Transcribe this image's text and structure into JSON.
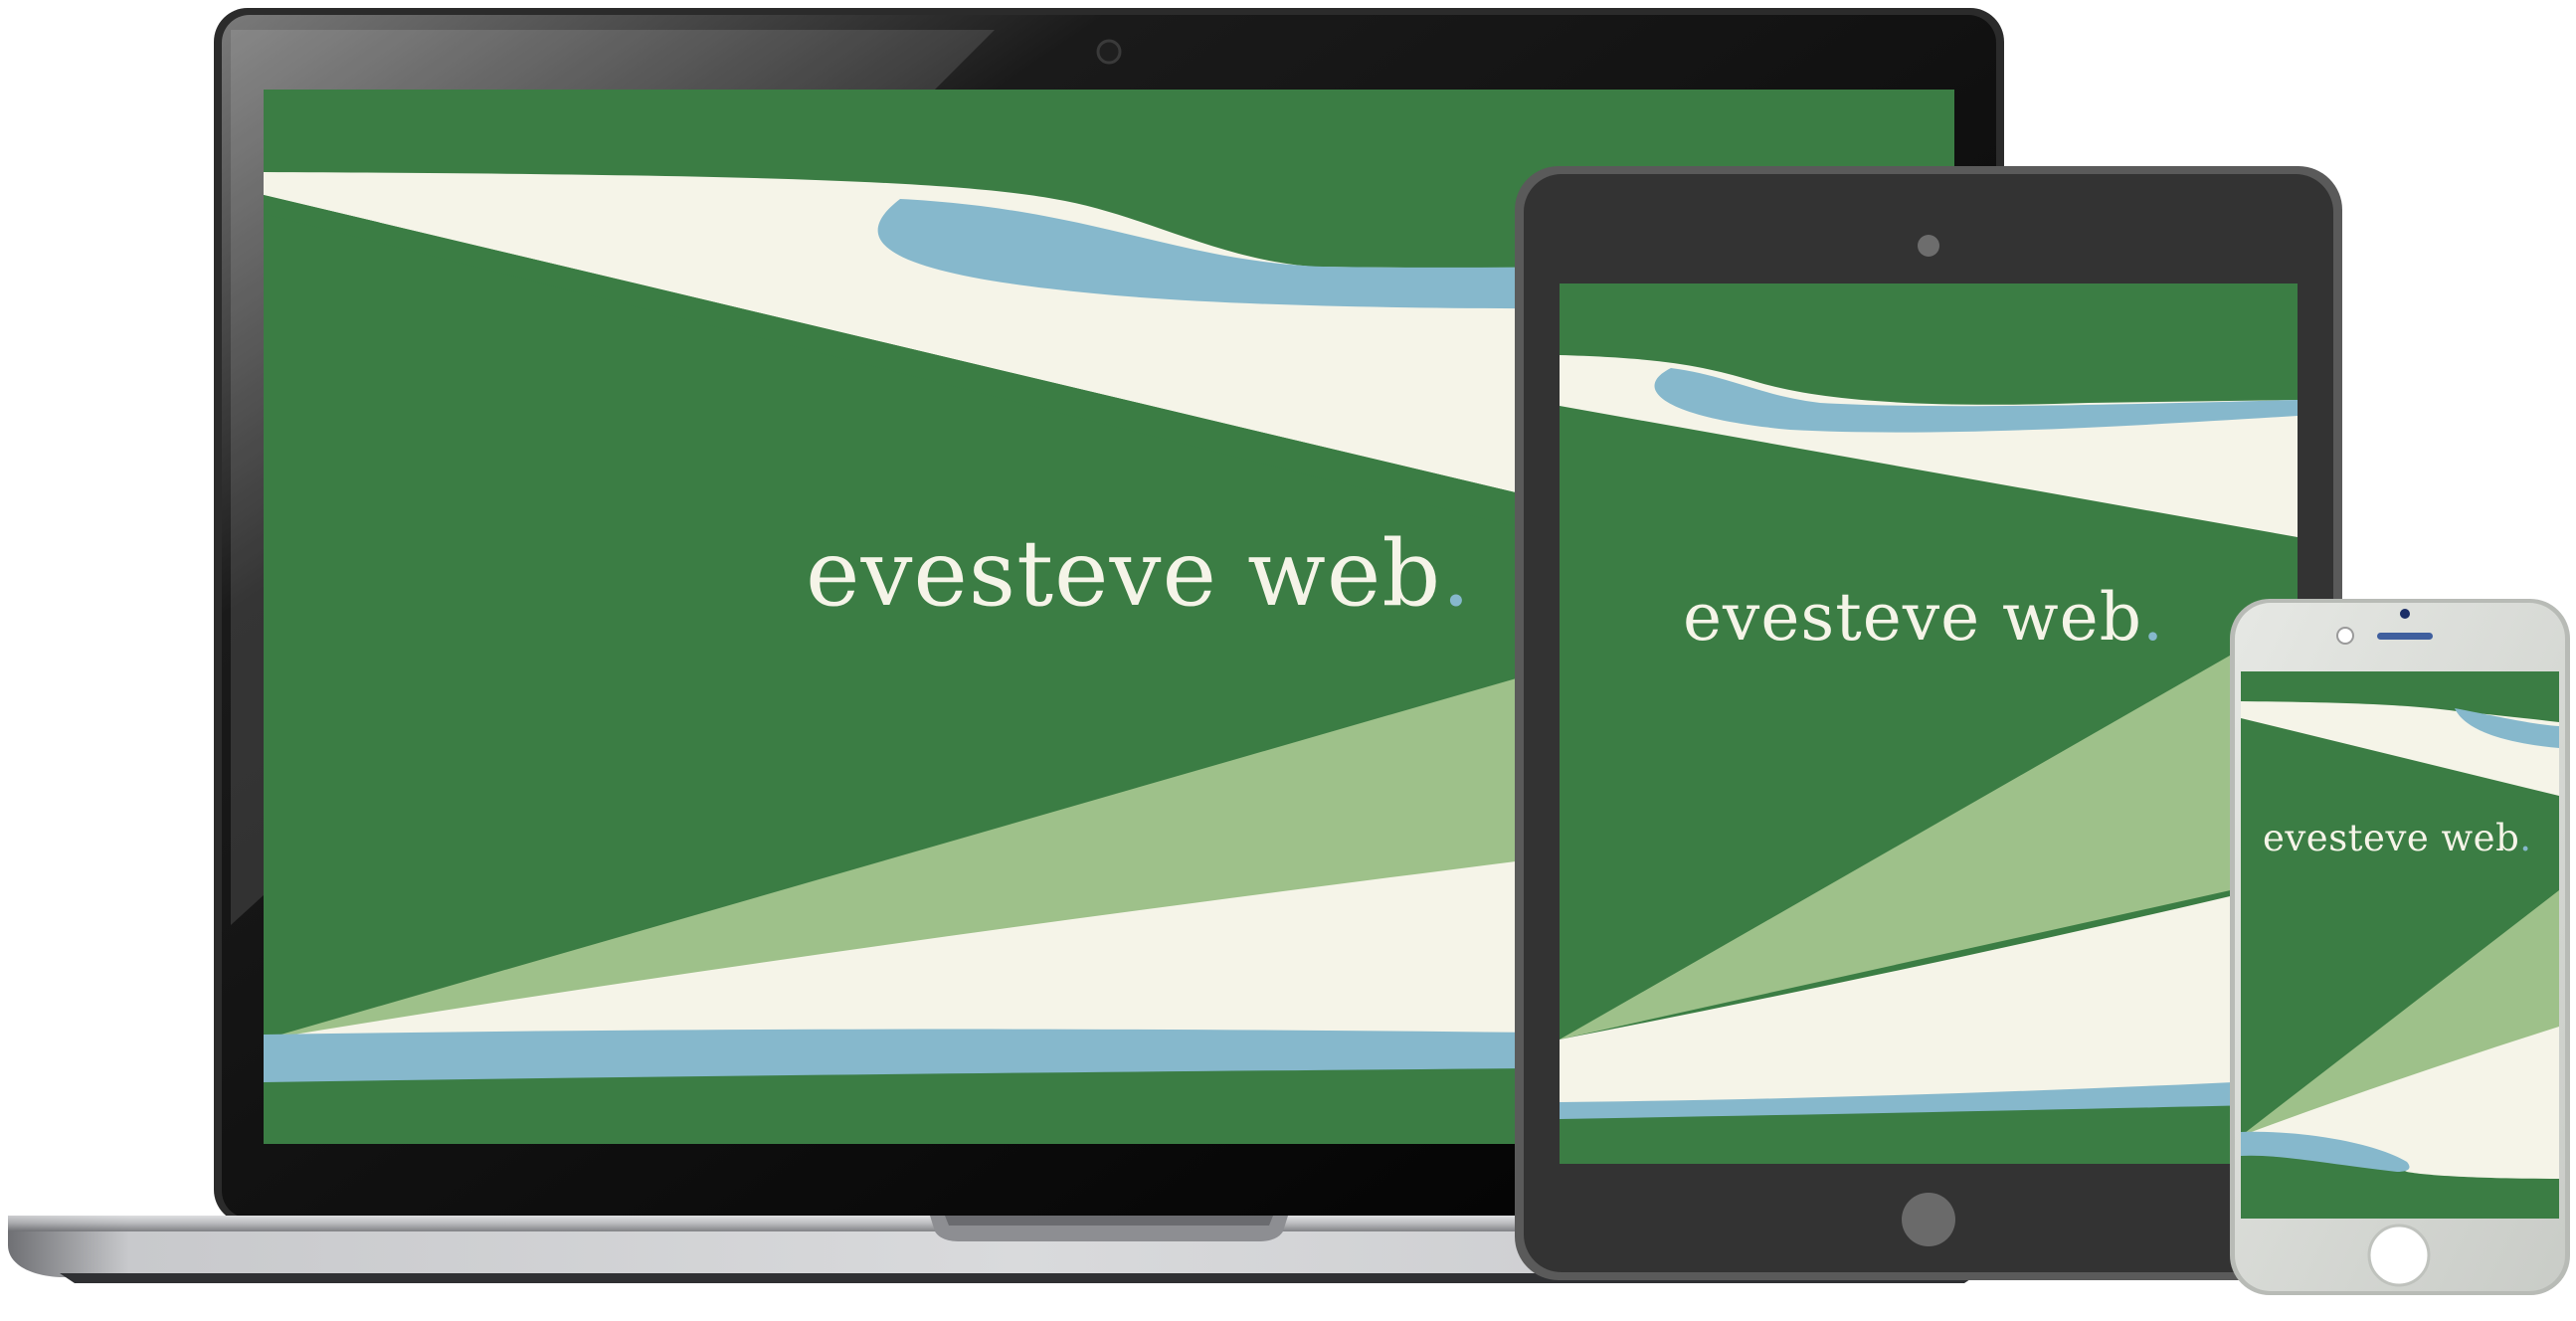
{
  "brand": {
    "name": "evesteve web",
    "period": "."
  },
  "colors": {
    "dark_green": "#3b7d44",
    "light_green": "#9ec18a",
    "cream": "#f5f4e8",
    "light_blue": "#86b8cc",
    "laptop_bezel": "#050505",
    "laptop_base": "#a9aaae",
    "tablet_body": "#333333",
    "phone_body": "#d6d8d3"
  },
  "devices": [
    {
      "type": "laptop",
      "camera": "camera-icon"
    },
    {
      "type": "tablet",
      "camera": "camera-icon",
      "home": "home-button"
    },
    {
      "type": "phone",
      "camera": "camera-icon",
      "speaker": "speaker-icon",
      "home": "home-button"
    }
  ]
}
